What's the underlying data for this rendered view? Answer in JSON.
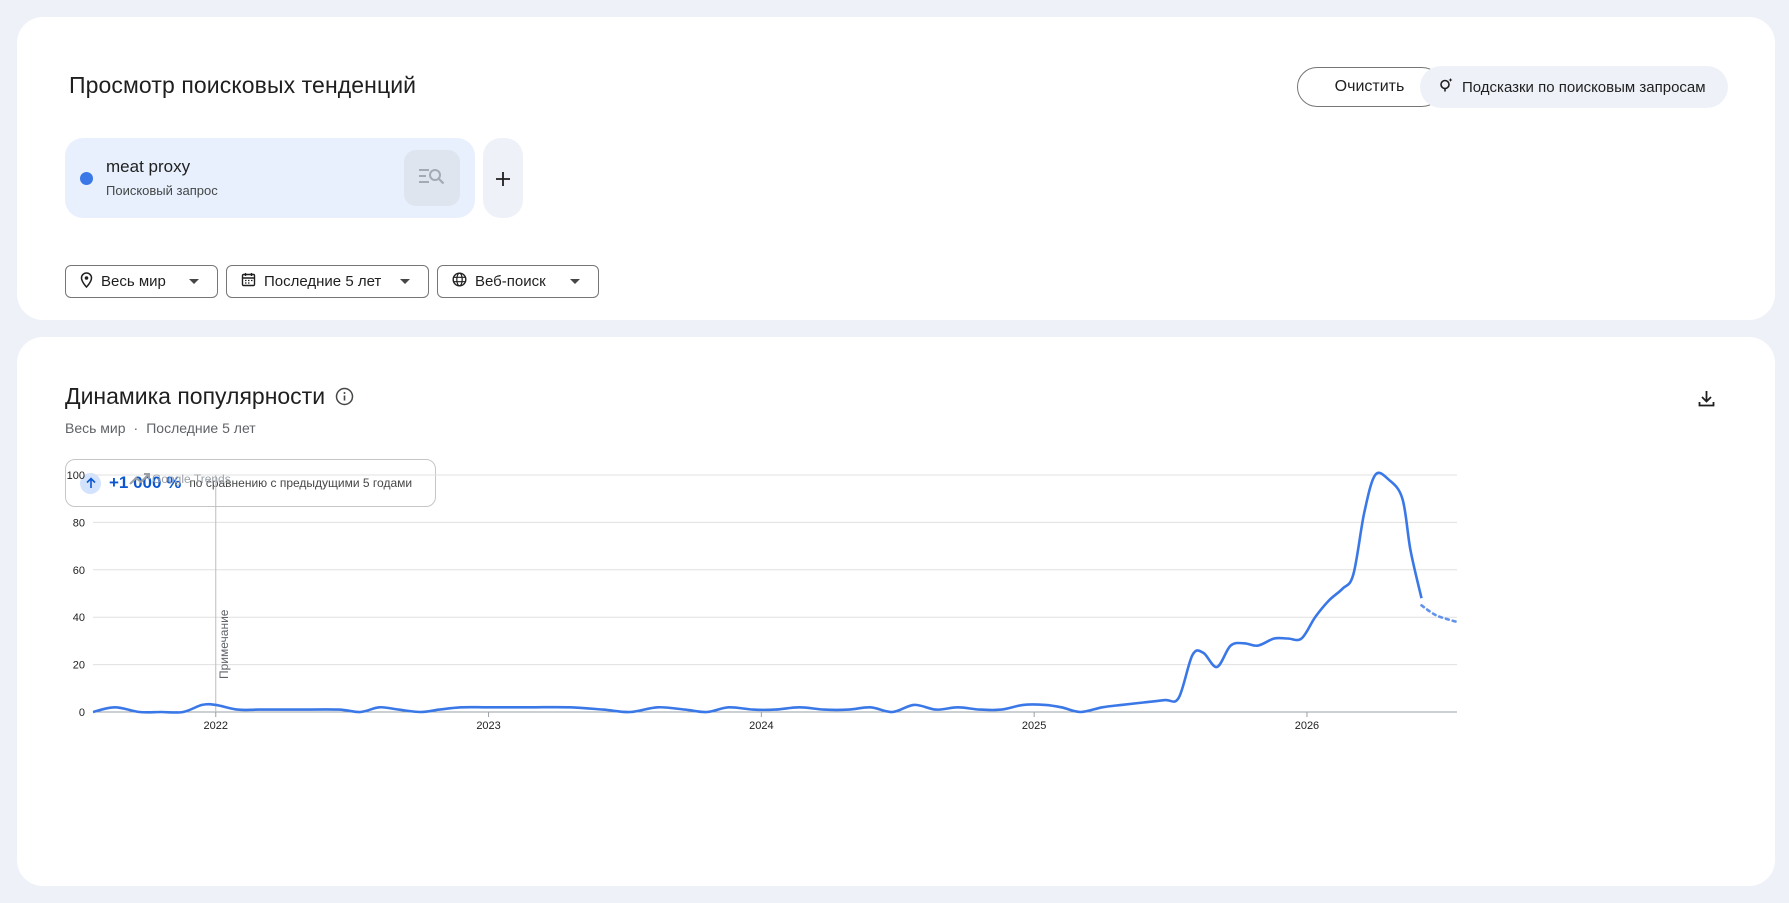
{
  "explore": {
    "title": "Просмотр поисковых тенденций",
    "clear_label": "Очистить",
    "suggestions_label": "Подсказки по поисковым запросам",
    "term": {
      "name": "meat proxy",
      "type": "Поисковый запрос",
      "color": "#3b78e7"
    },
    "add_icon": "plus-icon",
    "filters": {
      "location": "Весь мир",
      "time": "Последние 5 лет",
      "property": "Веб-поиск"
    }
  },
  "interest": {
    "title": "Динамика популярности",
    "subtitle_location": "Весь мир",
    "subtitle_separator": "·",
    "subtitle_time": "Последние 5 лет",
    "change_value": "+1 000 %",
    "change_text": "по сравнению с предыдущими 5 годами",
    "watermark": "Google Trends",
    "note_label": "Примечание"
  },
  "chart_data": {
    "type": "line",
    "ylim": [
      0,
      100
    ],
    "yticks": [
      0,
      20,
      40,
      60,
      80,
      100
    ],
    "xlim": [
      2021.55,
      2026.55
    ],
    "xticks": [
      {
        "value": 2022,
        "label": "2022"
      },
      {
        "value": 2023,
        "label": "2023"
      },
      {
        "value": 2024,
        "label": "2024"
      },
      {
        "value": 2025,
        "label": "2025"
      },
      {
        "value": 2026,
        "label": "2026"
      }
    ],
    "grid": true,
    "annotation": {
      "x": 2022,
      "label": "Примечание"
    },
    "series": [
      {
        "color": "#3b78e7",
        "x": [
          2021.55,
          2021.63,
          2021.72,
          2021.8,
          2021.88,
          2021.95,
          2022.0,
          2022.08,
          2022.16,
          2022.3,
          2022.45,
          2022.53,
          2022.6,
          2022.67,
          2022.75,
          2022.82,
          2022.9,
          2023.0,
          2023.15,
          2023.3,
          2023.42,
          2023.52,
          2023.62,
          2023.72,
          2023.8,
          2023.88,
          2023.97,
          2024.05,
          2024.14,
          2024.23,
          2024.32,
          2024.4,
          2024.48,
          2024.56,
          2024.64,
          2024.72,
          2024.8,
          2024.88,
          2024.96,
          2025.04,
          2025.1,
          2025.17,
          2025.25,
          2025.32,
          2025.4,
          2025.48,
          2025.53,
          2025.58,
          2025.62,
          2025.67,
          2025.72,
          2025.77,
          2025.82,
          2025.88,
          2025.93,
          2025.98,
          2026.03,
          2026.08,
          2026.13,
          2026.17,
          2026.21,
          2026.25,
          2026.3,
          2026.35,
          2026.38,
          2026.42
        ],
        "y": [
          0,
          2,
          0,
          0,
          0,
          3,
          3,
          1,
          1,
          1,
          1,
          0,
          2,
          1,
          0,
          1,
          2,
          2,
          2,
          2,
          1,
          0,
          2,
          1,
          0,
          2,
          1,
          1,
          2,
          1,
          1,
          2,
          0,
          3,
          1,
          2,
          1,
          1,
          3,
          3,
          2,
          0,
          2,
          3,
          4,
          5,
          6,
          24,
          25,
          19,
          28,
          29,
          28,
          31,
          31,
          31,
          40,
          47,
          52,
          58,
          84,
          100,
          98,
          90,
          68,
          48
        ]
      }
    ],
    "forecast": {
      "x": [
        2026.42,
        2026.47,
        2026.52,
        2026.55
      ],
      "y": [
        45,
        41,
        39,
        38
      ]
    }
  }
}
